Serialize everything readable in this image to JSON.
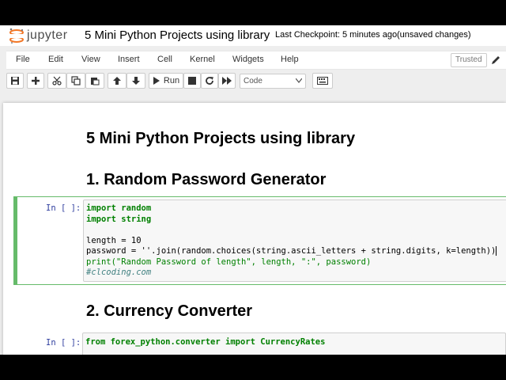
{
  "header": {
    "logo_text": "jupyter",
    "notebook_title": "5 Mini Python Projects using library",
    "checkpoint": "Last Checkpoint: 5 minutes ago",
    "unsaved": "(unsaved changes)"
  },
  "menubar": {
    "items": [
      "File",
      "Edit",
      "View",
      "Insert",
      "Cell",
      "Kernel",
      "Widgets",
      "Help"
    ],
    "trusted": "Trusted"
  },
  "toolbar": {
    "run_label": "Run",
    "cell_type": "Code",
    "icons": [
      "save-icon",
      "plus-icon",
      "cut-icon",
      "copy-icon",
      "paste-icon",
      "arrow-up-icon",
      "arrow-down-icon",
      "play-icon",
      "stop-icon",
      "restart-icon",
      "fast-forward-icon",
      "keyboard-icon"
    ]
  },
  "notebook": {
    "heading1": "5 Mini Python Projects using library",
    "heading2a": "1. Random Password Generator",
    "heading2b": "2. Currency Converter",
    "cell1_prompt": "In [ ]:",
    "cell1_lines": [
      "import random",
      "import string",
      "",
      "length = 10",
      "password = ''.join(random.choices(string.ascii_letters + string.digits, k=length))",
      "print(\"Random Password of length\", length, \":\", password)",
      "#clcoding.com"
    ],
    "cell2_prompt": "In [ ]:",
    "cell2_lines": [
      "from forex_python.converter import CurrencyRates"
    ]
  },
  "colors": {
    "selected_cell_border": "#66bb6a",
    "prompt": "#303f9f",
    "keyword": "#008000",
    "string": "#ba2121",
    "comment": "#408080"
  }
}
